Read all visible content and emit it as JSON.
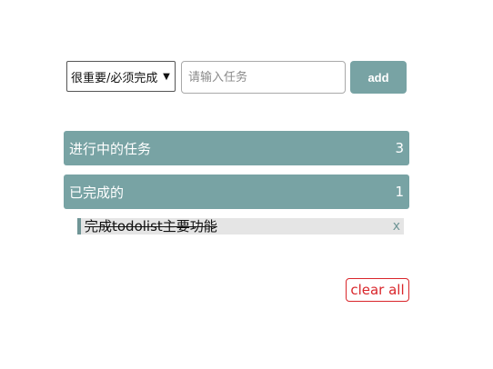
{
  "input_bar": {
    "priority_selected": "很重要/必须完成",
    "priority_arrow": "▼",
    "task_placeholder": "请输入任务",
    "task_value": "",
    "add_label": "add"
  },
  "sections": {
    "ongoing": {
      "title": "进行中的任务",
      "count": "3"
    },
    "done": {
      "title": "已完成的",
      "count": "1"
    }
  },
  "done_items": [
    {
      "text": "完成todolist主要功能",
      "delete_label": "x"
    }
  ],
  "footer": {
    "clear_all_label": "clear all"
  },
  "colors": {
    "accent": "#78a3a4",
    "danger": "#d9262b",
    "item_bg": "#e5e5e5"
  }
}
